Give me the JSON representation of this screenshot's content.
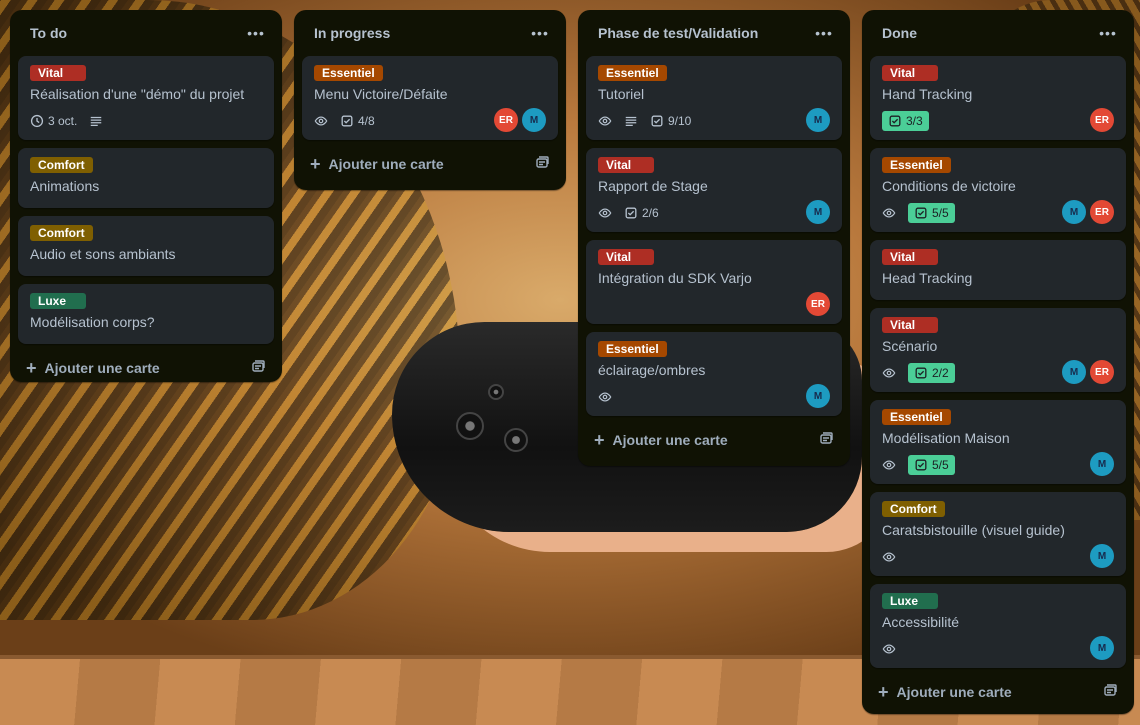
{
  "lists": [
    {
      "title": "To do",
      "cards": [
        {
          "label": "Vital",
          "title": "Réalisation d'une \"démo\" du projet",
          "date": "3 oct."
        },
        {
          "label": "Comfort",
          "title": "Animations"
        },
        {
          "label": "Comfort",
          "title": "Audio et sons ambiants"
        },
        {
          "label": "Luxe",
          "title": "Modélisation corps?"
        }
      ],
      "add_label": "Ajouter une carte"
    },
    {
      "title": "In progress",
      "cards": [
        {
          "label": "Essentiel",
          "title": "Menu Victoire/Défaite",
          "checklist": "4/8",
          "members": [
            "ER",
            "M"
          ]
        }
      ],
      "add_label": "Ajouter une carte"
    },
    {
      "title": "Phase de test/Validation",
      "cards": [
        {
          "label": "Essentiel",
          "title": "Tutoriel",
          "checklist": "9/10",
          "members": [
            "M"
          ]
        },
        {
          "label": "Vital",
          "title": "Rapport de Stage",
          "checklist": "2/6",
          "members": [
            "M"
          ]
        },
        {
          "label": "Vital",
          "title": "Intégration du SDK Varjo",
          "members": [
            "ER"
          ]
        },
        {
          "label": "Essentiel",
          "title": "éclairage/ombres",
          "members": [
            "M"
          ]
        }
      ],
      "add_label": "Ajouter une carte"
    },
    {
      "title": "Done",
      "cards": [
        {
          "label": "Vital",
          "title": "Hand Tracking",
          "checklist": "3/3",
          "members": [
            "ER"
          ]
        },
        {
          "label": "Essentiel",
          "title": "Conditions de victoire",
          "checklist": "5/5",
          "members": [
            "M",
            "ER"
          ]
        },
        {
          "label": "Vital",
          "title": "Head Tracking"
        },
        {
          "label": "Vital",
          "title": "Scénario",
          "checklist": "2/2",
          "members": [
            "M",
            "ER"
          ]
        },
        {
          "label": "Essentiel",
          "title": "Modélisation Maison",
          "checklist": "5/5",
          "members": [
            "M"
          ]
        },
        {
          "label": "Comfort",
          "title": "Caratsbistouille (visuel guide)",
          "members": [
            "M"
          ]
        },
        {
          "label": "Luxe",
          "title": "Accessibilité",
          "members": [
            "M"
          ]
        }
      ],
      "add_label": "Ajouter une carte"
    }
  ],
  "icons": {
    "list_menu": "ellipsis-icon",
    "clock": "clock-icon",
    "description": "description-icon",
    "watch": "eye-icon",
    "checklist": "checklist-icon",
    "add": "plus-icon",
    "template": "card-template-icon"
  },
  "colors": {
    "vital": "#ae2e24",
    "essentiel": "#a54800",
    "comfort": "#7f5f01",
    "luxe": "#216e4e",
    "checklist_complete": "#4bce97",
    "avatar_er": "#e34935",
    "avatar_m": "#1d9bc1"
  }
}
